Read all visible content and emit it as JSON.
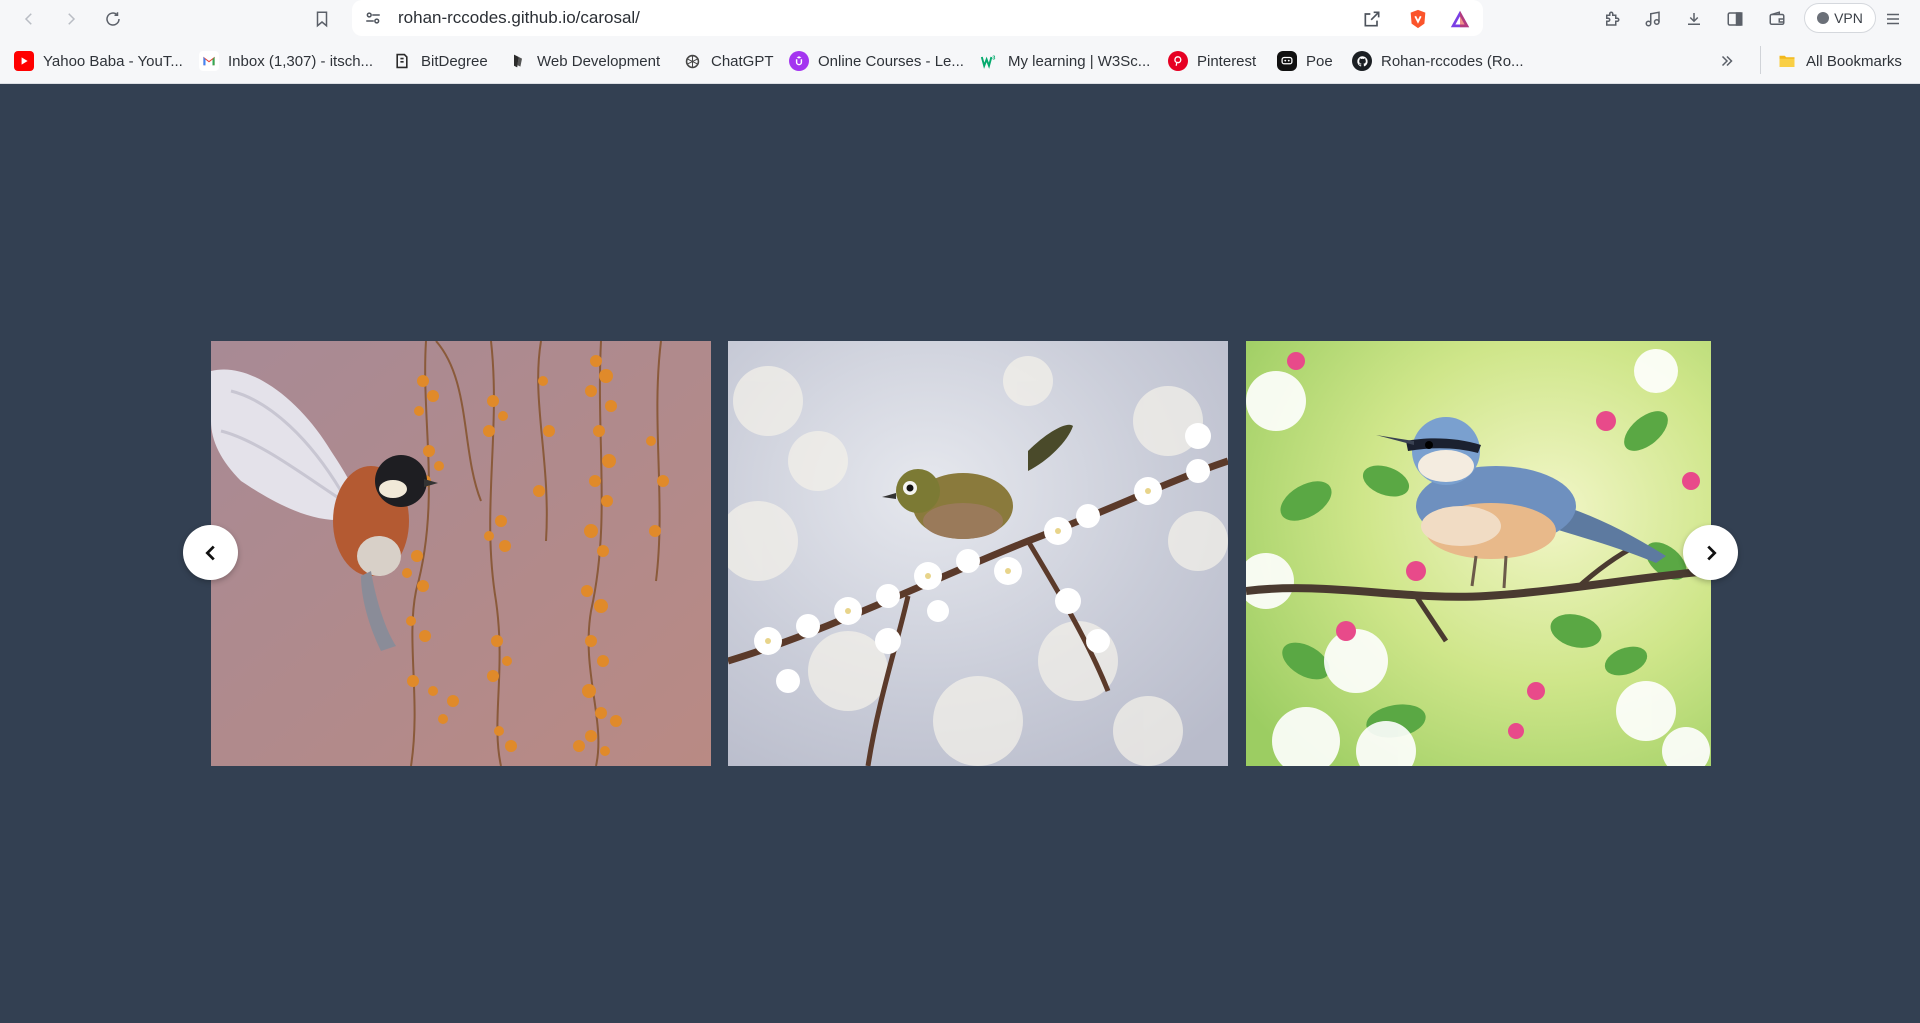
{
  "browser": {
    "url": "rohan-rccodes.github.io/carosal/",
    "vpn_label": "VPN",
    "icons": {
      "back": "back-arrow-icon",
      "forward": "forward-arrow-icon",
      "reload": "reload-icon",
      "bookmark": "bookmark-icon",
      "site_settings": "site-settings-icon",
      "share": "share-icon",
      "brave": "brave-shield-icon",
      "rewards": "brave-rewards-icon",
      "extensions": "extensions-icon",
      "media": "music-icon",
      "downloads": "download-icon",
      "sidebar": "sidebar-icon",
      "wallet": "wallet-icon",
      "menu": "hamburger-menu-icon"
    }
  },
  "bookmarks": {
    "items": [
      {
        "label": "Yahoo Baba - YouT...",
        "icon": "youtube-icon",
        "color": "#ff0000"
      },
      {
        "label": "Inbox (1,307) - itsch...",
        "icon": "gmail-icon",
        "color": "#ea4335"
      },
      {
        "label": "BitDegree",
        "icon": "bitdegree-icon",
        "color": "#2b2b2b"
      },
      {
        "label": "Web Development",
        "icon": "webdev-icon",
        "color": "#2b2b2b"
      },
      {
        "label": "ChatGPT",
        "icon": "chatgpt-icon",
        "color": "#444444"
      },
      {
        "label": "Online Courses - Le...",
        "icon": "udemy-icon",
        "color": "#a435f0"
      },
      {
        "label": "My learning | W3Sc...",
        "icon": "w3schools-icon",
        "color": "#04aa6d"
      },
      {
        "label": "Pinterest",
        "icon": "pinterest-icon",
        "color": "#e60023"
      },
      {
        "label": "Poe",
        "icon": "poe-icon",
        "color": "#111111"
      },
      {
        "label": "Rohan-rccodes (Ro...",
        "icon": "github-icon",
        "color": "#1b1f23"
      }
    ],
    "overflow_icon": "chevron-double-right-icon",
    "all_bookmarks_label": "All Bookmarks",
    "all_bookmarks_icon": "folder-icon"
  },
  "carousel": {
    "background": "#334052",
    "slides": [
      {
        "subject": "bird in flight among orange berries"
      },
      {
        "subject": "small green bird on white blossom branch"
      },
      {
        "subject": "nuthatch on branch with pink blossoms"
      }
    ],
    "prev_icon": "chevron-left-icon",
    "next_icon": "chevron-right-icon"
  }
}
